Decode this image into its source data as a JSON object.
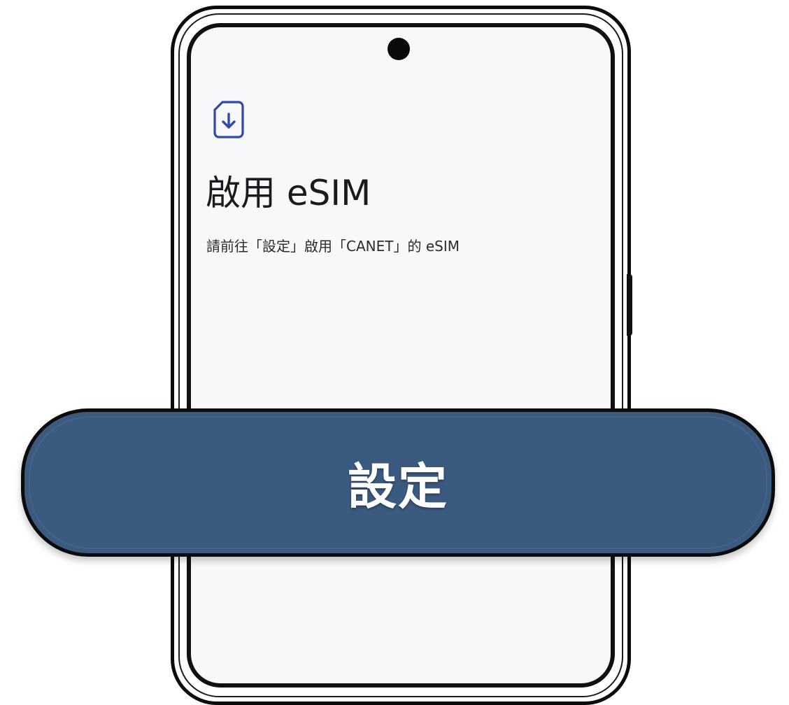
{
  "screen": {
    "icon": "esim-download-icon",
    "title": "啟用 eSIM",
    "message": "請前往「設定」啟用「CANET」的 eSIM"
  },
  "action": {
    "label": "設定"
  },
  "colors": {
    "accent_icon": "#2f4aa8",
    "button_fill": "#3b5a7f",
    "screen_bg": "#f8f8fa"
  }
}
